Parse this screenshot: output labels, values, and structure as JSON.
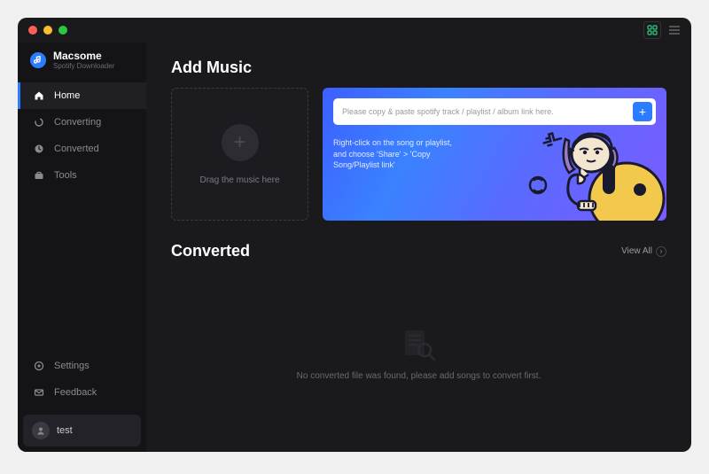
{
  "brand": {
    "name": "Macsome",
    "subtitle": "Spotify Downloader"
  },
  "nav": [
    {
      "label": "Home",
      "icon": "home"
    },
    {
      "label": "Converting",
      "icon": "spinner"
    },
    {
      "label": "Converted",
      "icon": "clock"
    },
    {
      "label": "Tools",
      "icon": "briefcase"
    }
  ],
  "bottom_nav": [
    {
      "label": "Settings",
      "icon": "gear"
    },
    {
      "label": "Feedback",
      "icon": "mail"
    }
  ],
  "user": {
    "name": "test"
  },
  "add_music": {
    "title": "Add Music",
    "dropzone_label": "Drag the music here",
    "input_placeholder": "Please copy & paste spotify track / playlist / album link here.",
    "tip": "Right-click on the song or playlist, and choose 'Share' > 'Copy Song/Playlist link'"
  },
  "converted": {
    "title": "Converted",
    "viewall": "View All",
    "empty": "No converted file was found, please add songs to convert first."
  }
}
